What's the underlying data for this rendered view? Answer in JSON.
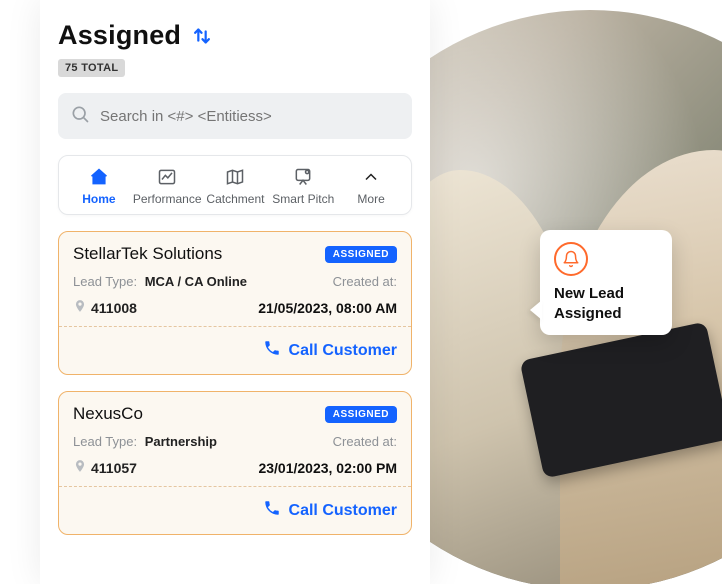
{
  "header": {
    "title": "Assigned",
    "total_badge": "75 TOTAL"
  },
  "search": {
    "placeholder": "Search in <#> <Entitiess>"
  },
  "tabs": [
    {
      "key": "home",
      "label": "Home",
      "active": true
    },
    {
      "key": "performance",
      "label": "Performance",
      "active": false
    },
    {
      "key": "catchment",
      "label": "Catchment",
      "active": false
    },
    {
      "key": "smartpitch",
      "label": "Smart Pitch",
      "active": false
    },
    {
      "key": "more",
      "label": "More",
      "active": false
    }
  ],
  "leads": [
    {
      "company": "StellarTek Solutions",
      "status": "ASSIGNED",
      "lead_type_label": "Lead Type:",
      "lead_type_value": "MCA / CA Online",
      "created_label": "Created at:",
      "zip": "411008",
      "created_at": "21/05/2023, 08:00 AM",
      "cta": "Call Customer"
    },
    {
      "company": "NexusCo",
      "status": "ASSIGNED",
      "lead_type_label": "Lead Type:",
      "lead_type_value": "Partnership",
      "created_label": "Created at:",
      "zip": "411057",
      "created_at": "23/01/2023, 02:00 PM",
      "cta": "Call Customer"
    }
  ],
  "notification": {
    "text": "New Lead Assigned"
  }
}
